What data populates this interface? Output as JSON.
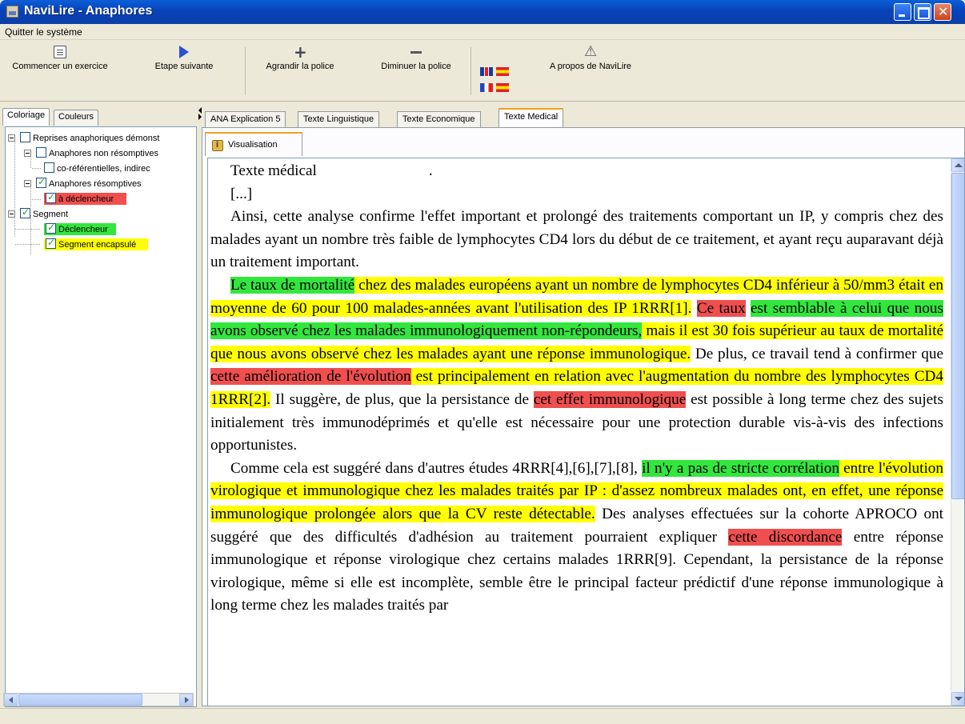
{
  "window": {
    "title": "NaviLire - Anaphores"
  },
  "menu": {
    "items": [
      "Quitter le système"
    ]
  },
  "toolbar": {
    "start_label": "Commencer un exercice",
    "next_label": "Etape suivante",
    "bigger_label": "Agrandir la police",
    "smaller_label": "Diminuer la police",
    "about_label": "A propos de NaviLire",
    "icons": {
      "start": "document-icon",
      "next": "arrow-right-icon",
      "bigger": "plus-icon",
      "smaller": "minus-icon",
      "about": "about-icon"
    }
  },
  "left": {
    "tabs": [
      "Coloriage",
      "Couleurs"
    ],
    "tree": {
      "root": "Reprises anaphoriques démonst",
      "non_resumptive": "Anaphores non résomptives",
      "coref": "co-référentielles, indirec",
      "resumptive": "Anaphores résomptives",
      "trigger_anaphor": "à déclencheur",
      "segment": "Segment",
      "declencheur": "Déclencheur",
      "encapsulated": "Segment encapsulé"
    }
  },
  "right": {
    "tabs": [
      "ANA Explication 5",
      "Texte Linguistique",
      "Texte Economique",
      "Texte Medical"
    ],
    "active_tab": "Texte Medical",
    "subtab": "Visualisation"
  },
  "colors": {
    "red": "#ef4f4f",
    "green": "#33e63e",
    "yellow": "#ffff00"
  },
  "document": {
    "title": "Texte médical",
    "title_dot": ".",
    "bracket": "[...]",
    "p1": "Ainsi, cette analyse confirme l'effet important et prolongé des traitements comportant un IP, y compris chez des malades ayant un nombre très faible de lymphocytes CD4 lors du début de ce traitement, et ayant reçu auparavant déjà un traitement important.",
    "p2": {
      "s1": "Le taux de mortalité",
      "s2": " chez des malades européens ayant un nombre de lymphocytes CD4 inférieur à 50/mm3 était en moyenne de 60 pour 100 malades-années avant l'utilisation des IP 1RRR[1].",
      "s3": " ",
      "s4": "Ce taux",
      "s5": " ",
      "s6": "est semblable à celui que nous avons observé chez les malades immunologiquement non-répondeurs,",
      "s7": " mais il est 30 fois supérieur au taux de mortalité que nous avons observé chez les malades ayant une réponse immunologique.",
      "s8": " De plus, ce travail tend à confirmer que ",
      "s9": "cette amélioration de l'évolution",
      "s10": " est principalement en relation avec l'augmentation du nombre des lymphocytes CD4 1RRR[2].",
      "s11": " Il suggère, de plus, que la persistance de ",
      "s12": "cet effet immunologique",
      "s13": " est possible à long terme chez des sujets initialement très immunodéprimés et qu'elle est nécessaire pour une protection durable vis-à-vis des infections opportunistes."
    },
    "p3": {
      "s1": "Comme cela est suggéré dans d'autres études 4RRR[4],[6],[7],[8], ",
      "s2": "il n'y a pas de stricte corrélation",
      "s3": " entre l'évolution virologique et immunologique chez les malades traités par IP : d'assez nombreux malades ont, en effet, une réponse immunologique prolongée alors que la CV reste détectable.",
      "s4": " Des analyses effectuées sur la cohorte APROCO ont suggéré que des difficultés d'adhésion au traitement pourraient expliquer ",
      "s5": "cette discordance",
      "s6": " entre réponse immunologique et réponse virologique chez certains malades 1RRR[9]. Cependant, la persistance de la réponse virologique, même si elle est incomplète, semble être le principal facteur prédictif d'une réponse immunologique à long terme chez les malades traités par"
    }
  }
}
